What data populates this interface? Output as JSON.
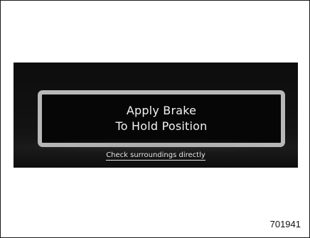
{
  "display": {
    "message_line_1": "Apply Brake",
    "message_line_2": "To Hold Position",
    "hint_text": "Check surroundings directly"
  },
  "figure": {
    "number": "701941"
  },
  "colors": {
    "display_background": "#0d0d0d",
    "message_border": "#b8b8b8",
    "text": "#f2f2f2"
  }
}
